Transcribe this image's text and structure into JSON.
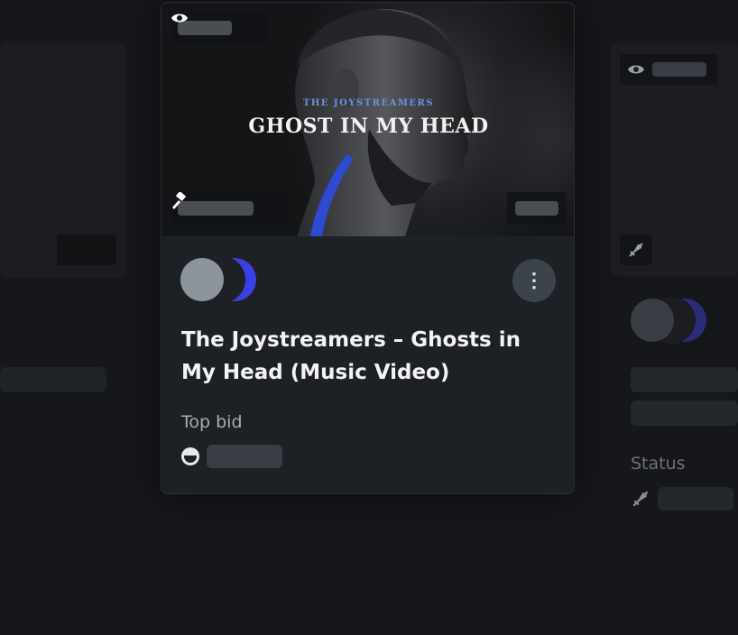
{
  "card": {
    "band_name": "THE JOYSTREAMERS",
    "media_title": "GHOST IN MY HEAD",
    "title": "The Joystreamers – Ghosts in My Head (Music Video)",
    "top_bid_label": "Top bid",
    "menu_glyph": "⋮",
    "icons": {
      "views": "eye-icon",
      "auction": "gavel-icon",
      "bidder": "bidder-avatar-icon",
      "menu": "more-vertical-icon"
    }
  },
  "right_card": {
    "status_label": "Status",
    "icons": [
      "eye-icon",
      "rocket-crossed-icon"
    ]
  },
  "colors": {
    "background": "#15171a",
    "card": "#1d2024",
    "accent_blue": "#3b3fe6",
    "band_text": "#6f8fe0"
  }
}
